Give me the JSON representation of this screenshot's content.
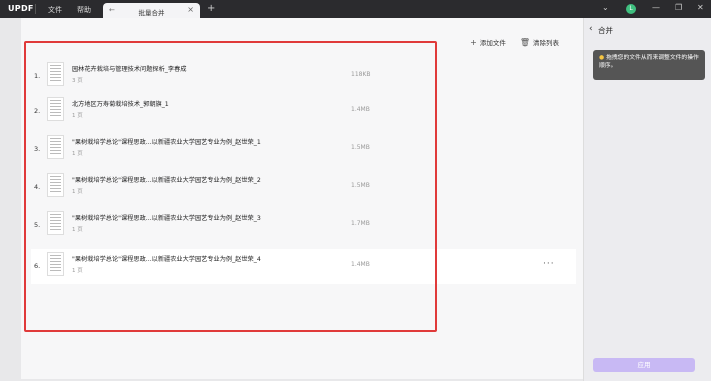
{
  "titlebar": {
    "logo": "UPDF",
    "menu": [
      "文件",
      "帮助"
    ],
    "tab_label": "批量合并",
    "avatar_initial": "L"
  },
  "toolbar": {
    "add_file": "添加文件",
    "clear_list": "清除列表"
  },
  "files": [
    {
      "index": "1.",
      "name": "园林花卉栽培与管理技术问题探析_李春成",
      "pages": "3 页",
      "size": "118KB"
    },
    {
      "index": "2.",
      "name": "北方地区万寿菊栽培技术_郭朝旗_1",
      "pages": "1 页",
      "size": "1.4MB"
    },
    {
      "index": "3.",
      "name": "\"果树栽培学总论\"课程思政...以新疆农业大学园艺专业为例_赵世荣_1",
      "pages": "1 页",
      "size": "1.5MB"
    },
    {
      "index": "4.",
      "name": "\"果树栽培学总论\"课程思政...以新疆农业大学园艺专业为例_赵世荣_2",
      "pages": "1 页",
      "size": "1.5MB"
    },
    {
      "index": "5.",
      "name": "\"果树栽培学总论\"课程思政...以新疆农业大学园艺专业为例_赵世荣_3",
      "pages": "1 页",
      "size": "1.7MB"
    },
    {
      "index": "6.",
      "name": "\"果树栽培学总论\"课程思政...以新疆农业大学园艺专业为例_赵世荣_4",
      "pages": "1 页",
      "size": "1.4MB"
    }
  ],
  "more_label": "···",
  "side": {
    "title": "合并",
    "hint": "拖拽您的文件从而来调整文件的操作顺序。",
    "apply": "应用"
  }
}
